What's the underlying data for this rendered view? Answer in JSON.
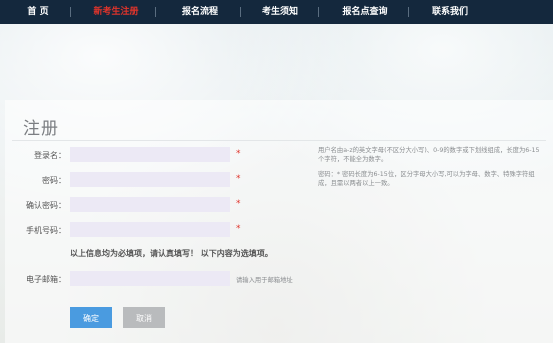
{
  "nav": {
    "items": [
      {
        "label": "首 页",
        "active": false
      },
      {
        "label": "新考生注册",
        "active": true
      },
      {
        "label": "报名流程",
        "active": false
      },
      {
        "label": "考生须知",
        "active": false
      },
      {
        "label": "报名点查询",
        "active": false
      },
      {
        "label": "联系我们",
        "active": false
      }
    ]
  },
  "form": {
    "title": "注册",
    "fields": [
      {
        "label": "登录名：",
        "value": "",
        "required": "*"
      },
      {
        "label": "密码：",
        "value": "",
        "required": "*"
      },
      {
        "label": "确认密码：",
        "value": "",
        "required": "*"
      },
      {
        "label": "手机号码：",
        "value": "",
        "required": "*"
      }
    ],
    "hint_login": "用户名由a-z的英文字母(不区分大小写)、0-9的数字或下划线组成，长度为6-15个字符，不能全为数字。",
    "hint_password": "密码：* 密码长度为6-15位，区分字母大小写,可以为字母、数字、特殊字符组成，且需以两者以上一致。",
    "notice": "以上信息均为必填项，请认真填写！ 以下内容为选填项。",
    "email": {
      "label": "电子邮箱：",
      "value": "",
      "hint": "请输入用于邮箱地址"
    },
    "buttons": {
      "ok": "确定",
      "cancel": "取消"
    }
  },
  "colors": {
    "nav_bg": "#14283d",
    "nav_active": "#e0342b",
    "field_bg": "#ece9f5",
    "ok_button": "#4a9be0",
    "cancel_button": "#b9bbbd"
  }
}
